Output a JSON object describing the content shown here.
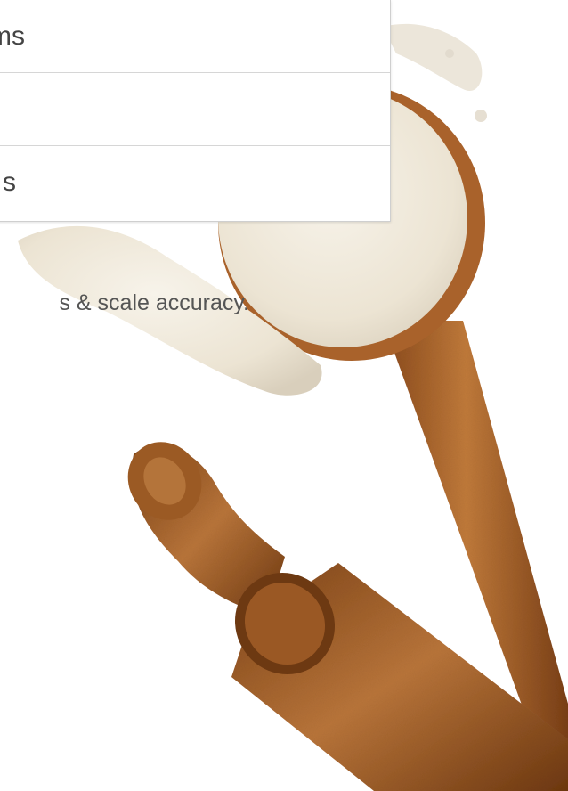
{
  "menu": {
    "items": [
      {
        "label": "ms"
      },
      {
        "label": ""
      },
      {
        "label": "s"
      }
    ]
  },
  "caption": "s & scale accuracy.",
  "colors": {
    "text": "#444444",
    "divider": "#d6d6d6",
    "wood": "#b06a2e",
    "flour": "#efe8dc"
  },
  "icons": [
    "flour-spoon-illustration",
    "rolling-pin-illustration"
  ]
}
